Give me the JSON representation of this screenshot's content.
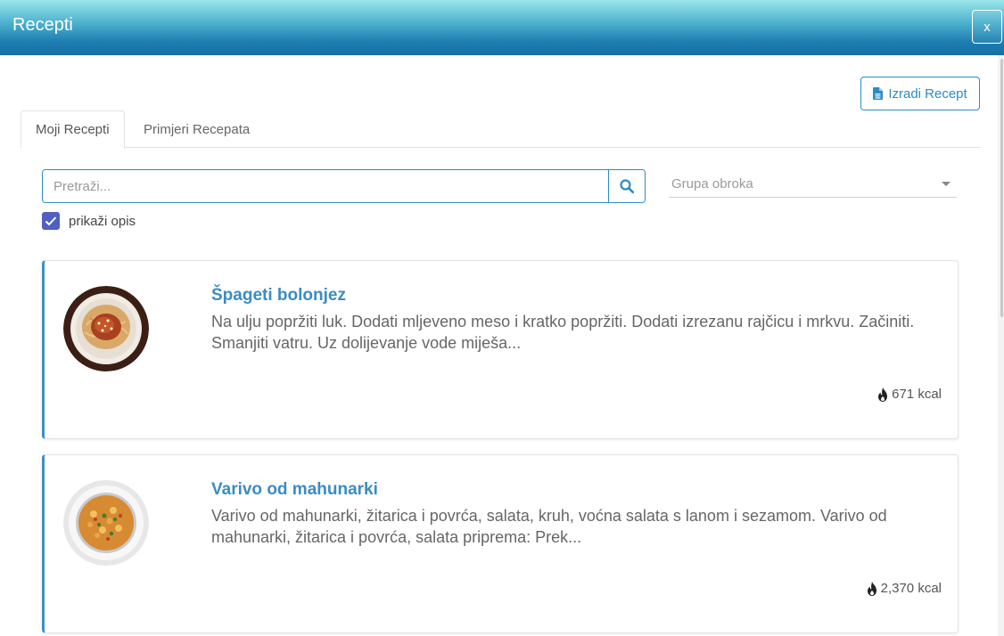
{
  "window": {
    "title": "Recepti",
    "close_label": "x"
  },
  "toolbar": {
    "create_label": "Izradi Recept"
  },
  "tabs": [
    {
      "label": "Moji Recepti",
      "active": true
    },
    {
      "label": "Primjeri Recepata",
      "active": false
    }
  ],
  "search": {
    "placeholder": "Pretraži...",
    "value": ""
  },
  "meal_group": {
    "placeholder": "Grupa obroka"
  },
  "show_description": {
    "label": "prikaži opis",
    "checked": true
  },
  "recipes": [
    {
      "title": "Špageti bolonjez",
      "description": "Na ulju popržiti luk. Dodati mljeveno meso i kratko popržiti. Dodati izrezanu rajčicu i mrkvu. Začiniti. Smanjiti vatru. Uz dolijevanje vode miješa...",
      "kcal": "671 kcal",
      "image_icon": "spaghetti-plate"
    },
    {
      "title": "Varivo od mahunarki",
      "description": "Varivo od mahunarki, žitarica i povrća, salata, kruh, voćna salata s lanom i sezamom. Varivo od mahunarki, žitarica i povrća, salata priprema: Prek...",
      "kcal": "2,370 kcal",
      "image_icon": "stew-bowl"
    }
  ],
  "colors": {
    "accent": "#2b8cc4",
    "card_border": "#3f8fc7",
    "checkbox": "#4f5fc2"
  }
}
